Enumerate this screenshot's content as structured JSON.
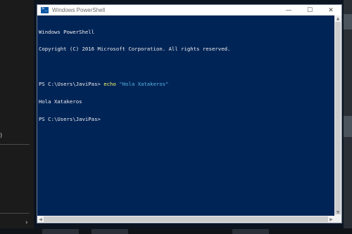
{
  "window": {
    "title": "Windows PowerShell",
    "controls": {
      "minimize": "—",
      "maximize": "☐",
      "close": "✕"
    }
  },
  "console": {
    "lines": [
      {
        "text": "Windows PowerShell"
      },
      {
        "text": "Copyright (C) 2016 Microsoft Corporation. All rights reserved."
      },
      {
        "text": ""
      },
      {
        "prompt": "PS C:\\Users\\JaviPas> ",
        "command": "echo",
        "argument": "\"Hola Xatakeros\""
      },
      {
        "text": "Hola Xatakeros"
      },
      {
        "text": "PS C:\\Users\\JaviPas> "
      }
    ]
  },
  "left_panel": {
    "fragment": ")",
    "chevron": "›"
  },
  "colors": {
    "console_bg": "#012456",
    "console_fg": "#eeedf0",
    "keyword": "#fefe6d",
    "string": "#57b7e8"
  }
}
